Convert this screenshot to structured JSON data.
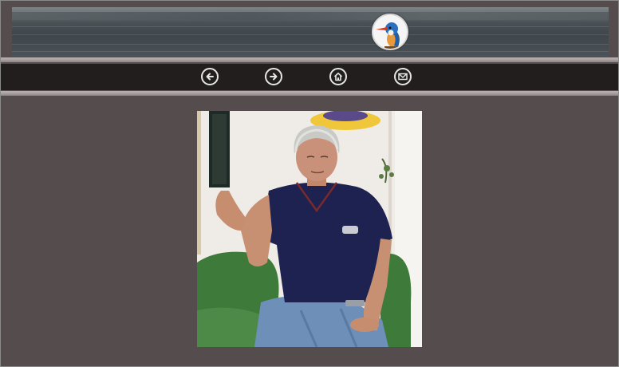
{
  "header": {
    "banner_name": "lake-banner",
    "logo_icon": "kingfisher-icon"
  },
  "nav": {
    "items": [
      {
        "name": "back-button",
        "icon": "arrow-left-icon"
      },
      {
        "name": "forward-button",
        "icon": "arrow-right-icon"
      },
      {
        "name": "home-button",
        "icon": "home-icon"
      },
      {
        "name": "mail-button",
        "icon": "envelope-icon"
      }
    ]
  },
  "photo": {
    "subject": "seated-man-photo"
  },
  "colors": {
    "page_background": "#554d4e",
    "navbar": "#221e1e",
    "rule": "#a9a0a0",
    "icon_stroke": "#e6e6e6"
  }
}
